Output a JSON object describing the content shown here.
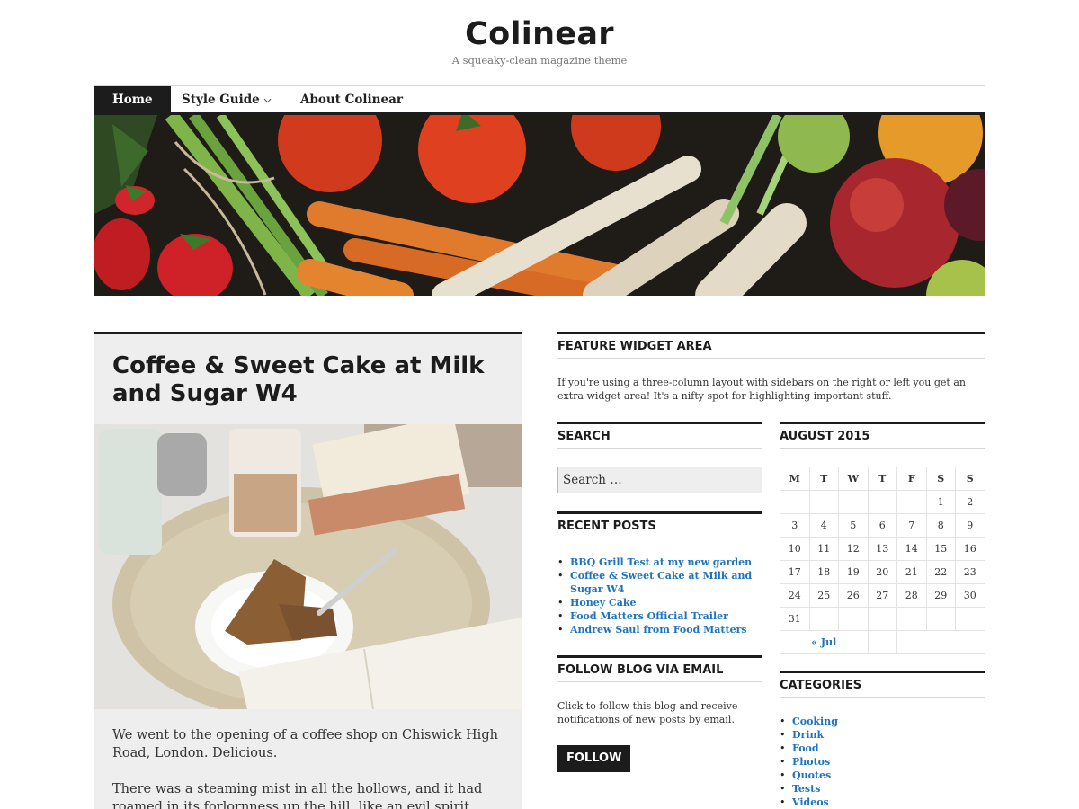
{
  "site": {
    "title": "Colinear",
    "description": "A squeaky-clean magazine theme"
  },
  "nav": {
    "items": [
      {
        "label": "Home",
        "active": true
      },
      {
        "label": "Style Guide",
        "has_dropdown": true
      },
      {
        "label": "About Colinear"
      }
    ],
    "dropdown_icon": "chevron-down-icon"
  },
  "banner": {
    "subject": "vegetables-and-fruit-header-image"
  },
  "post": {
    "title": "Coffee & Sweet Cake at Milk and Sugar W4",
    "image": "coffee-and-cake-photo",
    "paragraphs": [
      "We went to the opening of a coffee shop on Chiswick High Road, London. Delicious.",
      "There was a steaming mist in all the hollows, and it had roamed in its forlornness up the hill, like an evil spirit, seeking rest and finding"
    ]
  },
  "feature_widget": {
    "title": "FEATURE WIDGET AREA",
    "text": "If you're using a three-column layout with sidebars on the right or left you get an extra widget area! It's a nifty spot for highlighting important stuff."
  },
  "search_widget": {
    "title": "SEARCH",
    "placeholder": "Search …"
  },
  "recent_posts": {
    "title": "RECENT POSTS",
    "items": [
      "BBQ Grill Test at my new garden",
      "Coffee & Sweet Cake at Milk and Sugar W4",
      "Honey Cake",
      "Food Matters Official Trailer",
      "Andrew Saul from Food Matters"
    ]
  },
  "follow_widget": {
    "title": "FOLLOW BLOG VIA EMAIL",
    "text": "Click to follow this blog and receive notifications of new posts by email.",
    "button": "FOLLOW"
  },
  "calendar": {
    "title": "AUGUST 2015",
    "weekdays": [
      "M",
      "T",
      "W",
      "T",
      "F",
      "S",
      "S"
    ],
    "weeks": [
      [
        "",
        "",
        "",
        "",
        "",
        "1",
        "2"
      ],
      [
        "3",
        "4",
        "5",
        "6",
        "7",
        "8",
        "9"
      ],
      [
        "10",
        "11",
        "12",
        "13",
        "14",
        "15",
        "16"
      ],
      [
        "17",
        "18",
        "19",
        "20",
        "21",
        "22",
        "23"
      ],
      [
        "24",
        "25",
        "26",
        "27",
        "28",
        "29",
        "30"
      ],
      [
        "31",
        "",
        "",
        "",
        "",
        "",
        ""
      ]
    ],
    "prev_label": "« Jul"
  },
  "categories": {
    "title": "CATEGORIES",
    "items": [
      "Cooking",
      "Drink",
      "Food",
      "Photos",
      "Quotes",
      "Tests",
      "Videos"
    ]
  },
  "colors": {
    "accent": "#1c1c1c",
    "link": "#1e73be",
    "post_bg": "#eeeeee"
  }
}
